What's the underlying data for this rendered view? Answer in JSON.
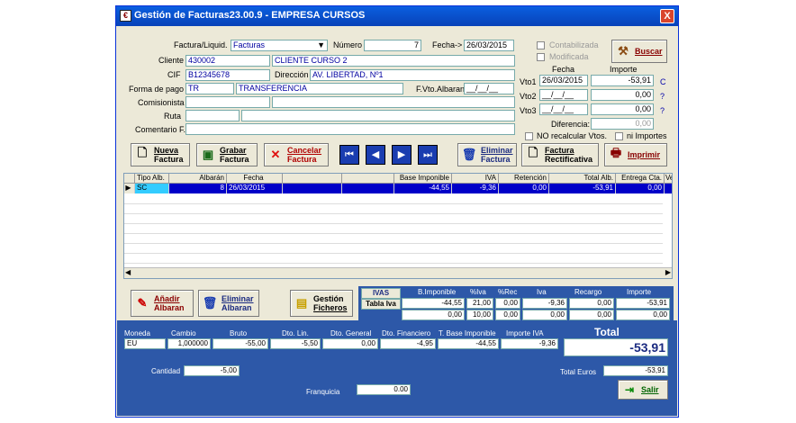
{
  "window": {
    "title": "Gestión de Facturas23.00.9 - EMPRESA CURSOS",
    "close": "X"
  },
  "header": {
    "tipo_label": "Factura/Liquid.",
    "tipo_value": "Facturas",
    "numero_label": "Número",
    "numero_value": "7",
    "fecha_label": "Fecha->",
    "fecha_value": "26/03/2015",
    "cliente_label": "Cliente",
    "cliente_code": "430002",
    "cliente_name": "CLIENTE CURSO 2",
    "cif_label": "CIF",
    "cif_value": "B12345678",
    "direccion_label": "Dirección",
    "direccion_value": "AV. LIBERTAD, Nº1",
    "pago_label": "Forma de pago",
    "pago_code": "TR",
    "pago_name": "TRANSFERENCIA",
    "fvto_label": "F.Vto.Albaran",
    "fvto_value": "__/__/__",
    "comisionista_label": "Comisionista",
    "ruta_label": "Ruta",
    "comentario_label": "Comentario F."
  },
  "flags": {
    "contabilizada": "Contabilizada",
    "modificada": "Modificada",
    "buscar": "Buscar"
  },
  "vto": {
    "fecha_header": "Fecha",
    "importe_header": "Importe",
    "rows": [
      {
        "label": "Vto1",
        "fecha": "26/03/2015",
        "importe": "-53,91",
        "mark": "C"
      },
      {
        "label": "Vto2",
        "fecha": "__/__/__",
        "importe": "0,00",
        "mark": "?"
      },
      {
        "label": "Vto3",
        "fecha": "__/__/__",
        "importe": "0,00",
        "mark": "?"
      }
    ],
    "diferencia_label": "Diferencia:",
    "diferencia_value": "0,00",
    "no_recalcular": "NO recalcular Vtos.",
    "ni_importes": "ni Importes"
  },
  "toolbar": {
    "nueva_a": "Nueva",
    "nueva_b": "Factura",
    "grabar_a": "Grabar",
    "grabar_b": "Factura",
    "cancelar_a": "Cancelar",
    "cancelar_b": "Factura",
    "eliminar_a": "Eliminar",
    "eliminar_b": "Factura",
    "rect_a": "Factura",
    "rect_b": "Rectificativa",
    "imprimir": "Imprimir"
  },
  "grid": {
    "headers": [
      "Tipo Alb.",
      "Albarán",
      "Fecha",
      "",
      "",
      "Base Imponible",
      "IVA",
      "Retención",
      "Total Alb.",
      "Entrega Cta.",
      "Ve"
    ],
    "rows": [
      [
        "SC",
        "8",
        "26/03/2015",
        "",
        "",
        "-44,55",
        "-9,36",
        "0,00",
        "-53,91",
        "0,00",
        ""
      ]
    ]
  },
  "bottom_buttons": {
    "anadir_a": "Añadir",
    "anadir_b": "Albaran",
    "elim_a": "Eliminar",
    "elim_b": "Albaran",
    "gestion_a": "Gestión",
    "gestion_b": "Ficheros"
  },
  "ivas": {
    "title": "IVAS",
    "tabla": "Tabla Iva",
    "headers": [
      "B.Imponible",
      "%Iva",
      "%Rec",
      "Iva",
      "Recargo",
      "Importe"
    ],
    "rows": [
      [
        "-44,55",
        "21,00",
        "0,00",
        "-9,36",
        "0,00",
        "-53,91"
      ],
      [
        "0,00",
        "10,00",
        "0,00",
        "0,00",
        "0,00",
        "0,00"
      ]
    ]
  },
  "totals": {
    "headers": [
      "Moneda",
      "Cambio",
      "Bruto",
      "Dto. Lin.",
      "Dto. General",
      "Dto. Financiero",
      "T. Base Imponible",
      "Importe IVA"
    ],
    "values": [
      "EU",
      "1,000000",
      "-55,00",
      "-5,50",
      "0,00",
      "-4,95",
      "-44,55",
      "-9,36"
    ],
    "total_label": "Total",
    "total_value": "-53,91",
    "cantidad_label": "Cantidad",
    "cantidad_value": "-5,00",
    "franquicia_label": "Franquicia",
    "franquicia_value": "0.00",
    "total_euros_label": "Total Euros",
    "total_euros_value": "-53,91",
    "salir": "Salir"
  }
}
